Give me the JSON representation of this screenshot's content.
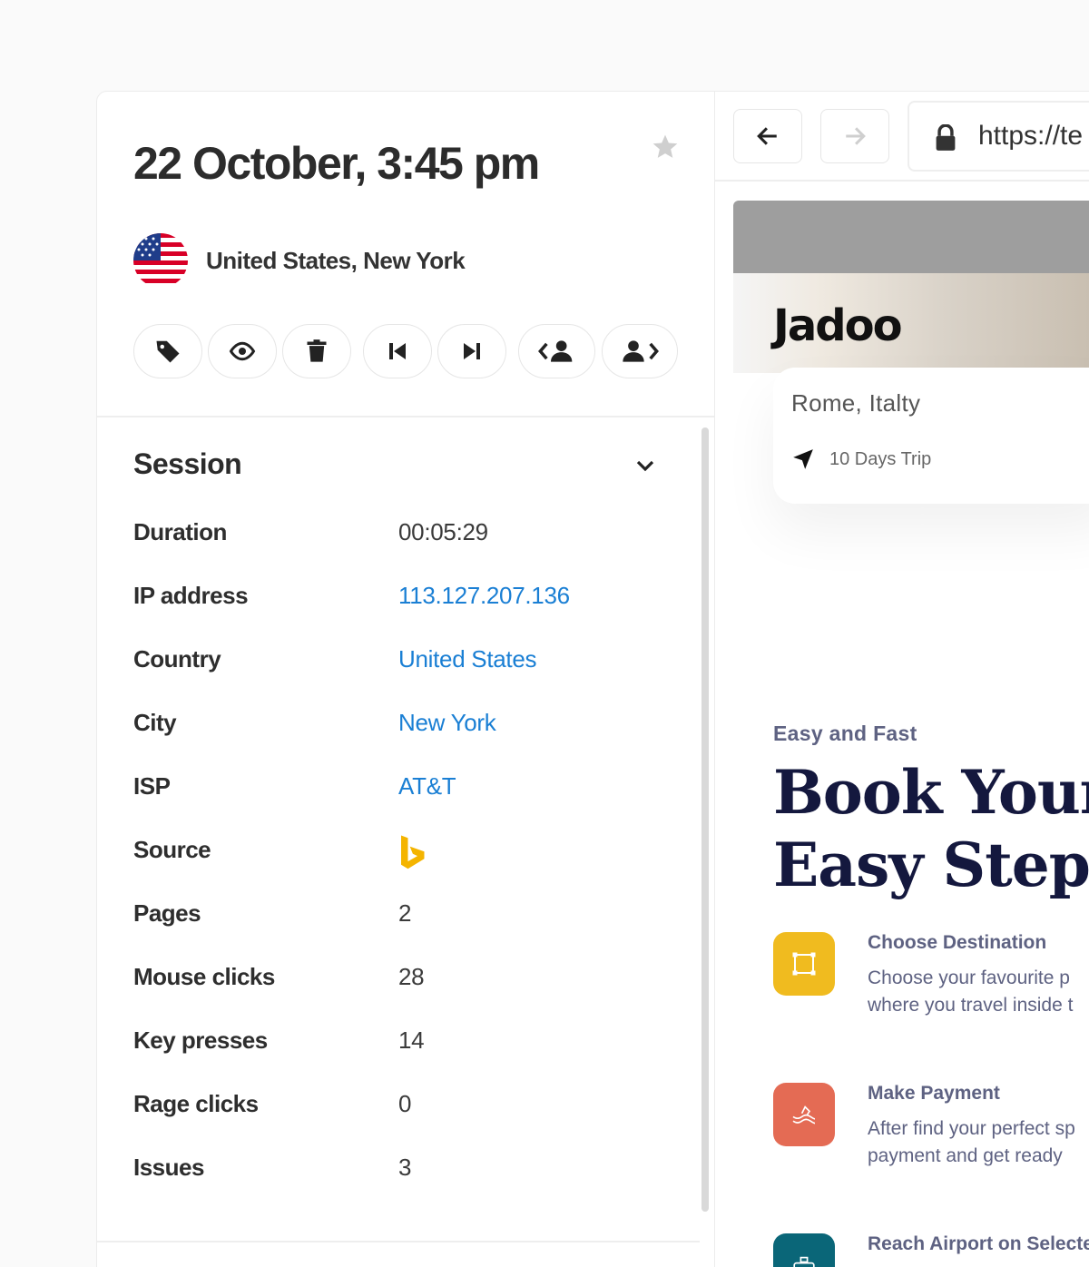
{
  "session_panel": {
    "timestamp": "22 October, 3:45 pm",
    "location": "United States, New York",
    "actions": [
      {
        "icon": "tag-icon"
      },
      {
        "icon": "eye-icon"
      },
      {
        "icon": "trash-icon"
      },
      {
        "icon": "skip-back-icon"
      },
      {
        "icon": "skip-forward-icon"
      },
      {
        "icon": "previous-user-icon"
      },
      {
        "icon": "next-user-icon"
      }
    ],
    "section_title": "Session",
    "rows": [
      {
        "label": "Duration",
        "value": "00:05:29",
        "link": false
      },
      {
        "label": "IP address",
        "value": "113.127.207.136",
        "link": true
      },
      {
        "label": "Country",
        "value": "United States",
        "link": true
      },
      {
        "label": "City",
        "value": "New York",
        "link": true
      },
      {
        "label": "ISP",
        "value": "AT&T",
        "link": true
      },
      {
        "label": "Source",
        "value": "",
        "icon": "bing-icon",
        "link": false
      },
      {
        "label": "Pages",
        "value": "2",
        "link": false
      },
      {
        "label": "Mouse clicks",
        "value": "28",
        "link": false
      },
      {
        "label": "Key presses",
        "value": "14",
        "link": false
      },
      {
        "label": "Rage clicks",
        "value": "0",
        "link": false
      },
      {
        "label": "Issues",
        "value": "3",
        "link": false
      }
    ]
  },
  "browser": {
    "url": "https://te",
    "page": {
      "logo": "Jadoo",
      "card_title": "Rome, Italty",
      "card_sub": "10 Days Trip",
      "eyebrow": "Easy and Fast",
      "headline_line1": "Book Your",
      "headline_line2": "Easy Steps",
      "steps": [
        {
          "title": "Choose Destination",
          "desc1": "Choose your favourite p",
          "desc2": "where you travel inside t",
          "color": "#f0bb1f"
        },
        {
          "title": "Make Payment",
          "desc1": "After find your perfect sp",
          "desc2": "payment and get ready",
          "color": "#f15a2b"
        },
        {
          "title": "Reach Airport on Selecte",
          "desc1": "",
          "desc2": "",
          "color": "#006380"
        }
      ]
    }
  },
  "colors": {
    "link": "#1a7fd4",
    "bing": "#f4b400"
  }
}
